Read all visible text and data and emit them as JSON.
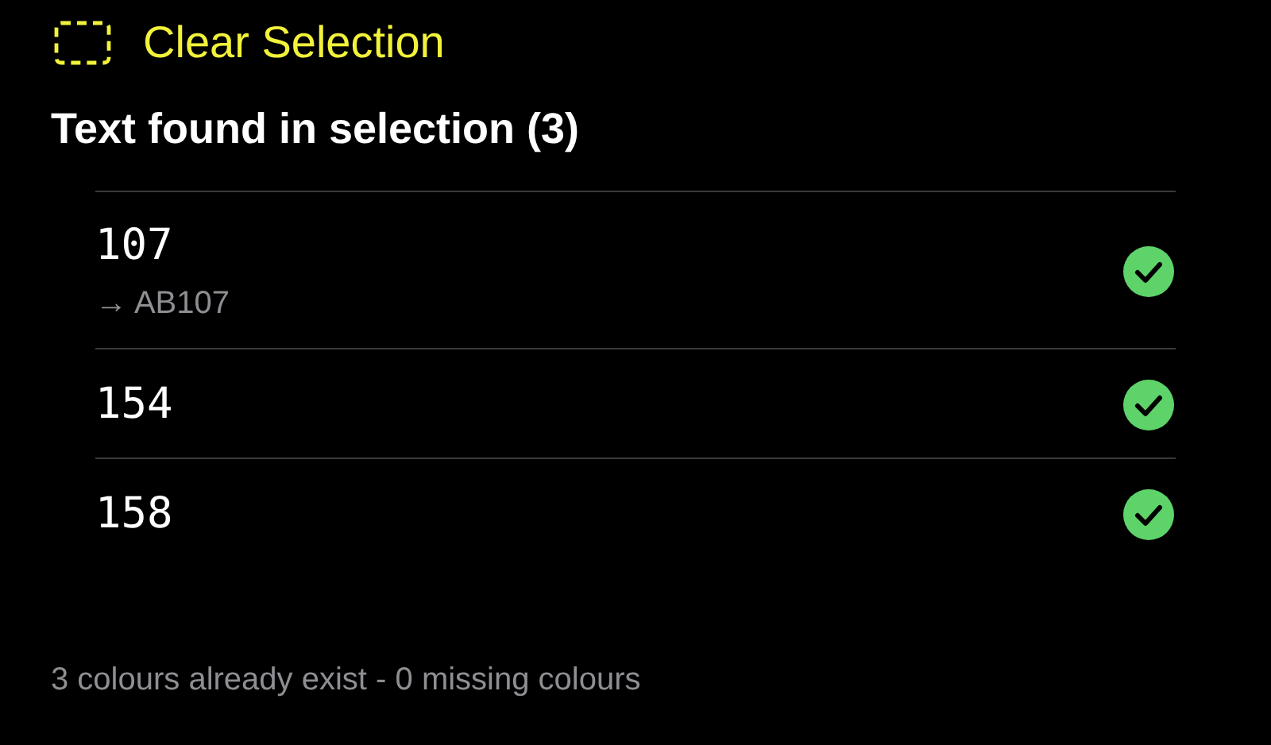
{
  "clear_selection": {
    "label": "Clear Selection"
  },
  "heading": "Text found in selection (3)",
  "results": [
    {
      "text": "107",
      "mapped": "→ AB107",
      "matched": true
    },
    {
      "text": "154",
      "matched": true
    },
    {
      "text": "158",
      "matched": true
    }
  ],
  "footer": "3 colours already exist - 0 missing colours"
}
